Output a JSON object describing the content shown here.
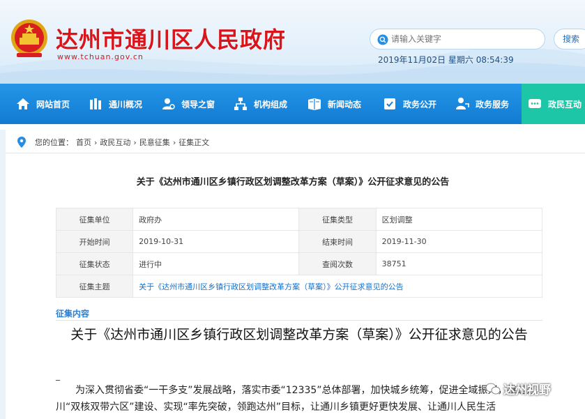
{
  "header": {
    "title": "达州市通川区人民政府",
    "domain": "www.tchuan.gov.cn",
    "search_placeholder": "请输入关键字",
    "search_button": "搜索",
    "datetime": "2019年11月02日 星期六 08:54:39"
  },
  "nav": {
    "items": [
      {
        "label": "网站首页",
        "icon": "home-icon"
      },
      {
        "label": "通川概况",
        "icon": "building-icon"
      },
      {
        "label": "领导之窗",
        "icon": "person-icon"
      },
      {
        "label": "机构组成",
        "icon": "org-chart-icon"
      },
      {
        "label": "新闻动态",
        "icon": "news-icon"
      },
      {
        "label": "政务公开",
        "icon": "check-doc-icon"
      },
      {
        "label": "政务服务",
        "icon": "service-icon"
      },
      {
        "label": "政民互动",
        "icon": "chat-icon"
      }
    ],
    "active": "政民互动",
    "colors": {
      "bar": "#1880d8",
      "active": "#1ec6a8"
    }
  },
  "breadcrumb": {
    "prefix": "您的位置：",
    "items": [
      "首页",
      "政民互动",
      "民意征集",
      "征集正文"
    ],
    "separator": "›"
  },
  "notice": {
    "title": "关于《达州市通川区乡镇行政区划调整改革方案（草案）》公开征求意见的公告"
  },
  "info_table": {
    "rows": [
      {
        "k1": "征集单位",
        "v1": "政府办",
        "k2": "征集类型",
        "v2": "区划调整"
      },
      {
        "k1": "开始时间",
        "v1": "2019-10-31",
        "k2": "结束时间",
        "v2": "2019-11-30"
      },
      {
        "k1": "征集状态",
        "v1": "进行中",
        "k2": "查阅次数",
        "v2": "38751"
      }
    ],
    "topic_label": "征集主题",
    "topic_value": "关于《达州市通川区乡镇行政区划调整改革方案（草案）》公开征求意见的公告"
  },
  "content": {
    "section_label": "征集内容",
    "big_title": "关于《达州市通川区乡镇行政区划调整改革方案（草案）》公开征求意见的公告",
    "dash": "_",
    "paragraph": "为深入贯彻省委“一干多支”发展战略，落实市委“12335”总体部署，加快城乡统筹，促进全域振兴，推进通川“双核双带六区”建设、实现“率先突破，领跑达州”目标，让通川乡镇更好更快发展、让通川人民生活"
  },
  "watermark": "达州视野",
  "colors": {
    "title_red": "#d9141b",
    "link_blue": "#1a6fc4"
  }
}
